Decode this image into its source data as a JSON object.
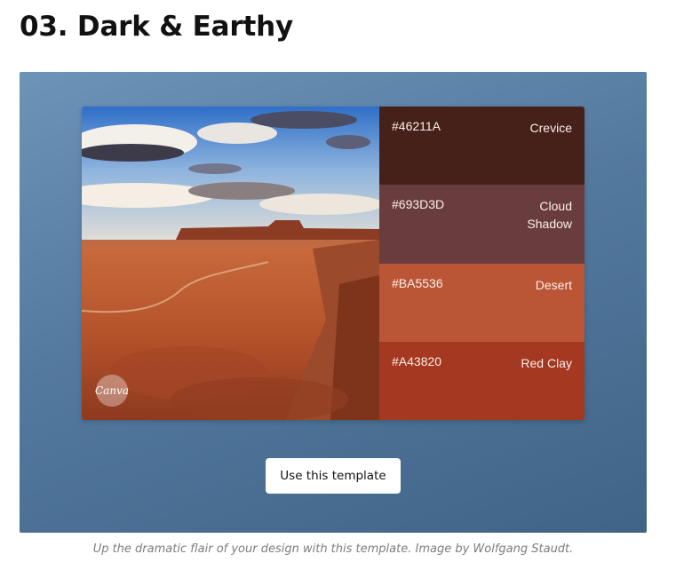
{
  "page": {
    "heading": "03. Dark & Earthy",
    "caption": "Up the dramatic flair of your design with this template. Image by Wolfgang Staudt."
  },
  "template": {
    "logo_text": "Canva",
    "button_label": "Use this template",
    "background_color": "#5a7ea3"
  },
  "palette": [
    {
      "hex": "#46211A",
      "name": "Crevice",
      "color": "#46211A"
    },
    {
      "hex": "#693D3D",
      "name": "Cloud Shadow",
      "color": "#693D3D"
    },
    {
      "hex": "#BA5536",
      "name": "Desert",
      "color": "#BA5536"
    },
    {
      "hex": "#A43820",
      "name": "Red Clay",
      "color": "#A43820"
    }
  ]
}
